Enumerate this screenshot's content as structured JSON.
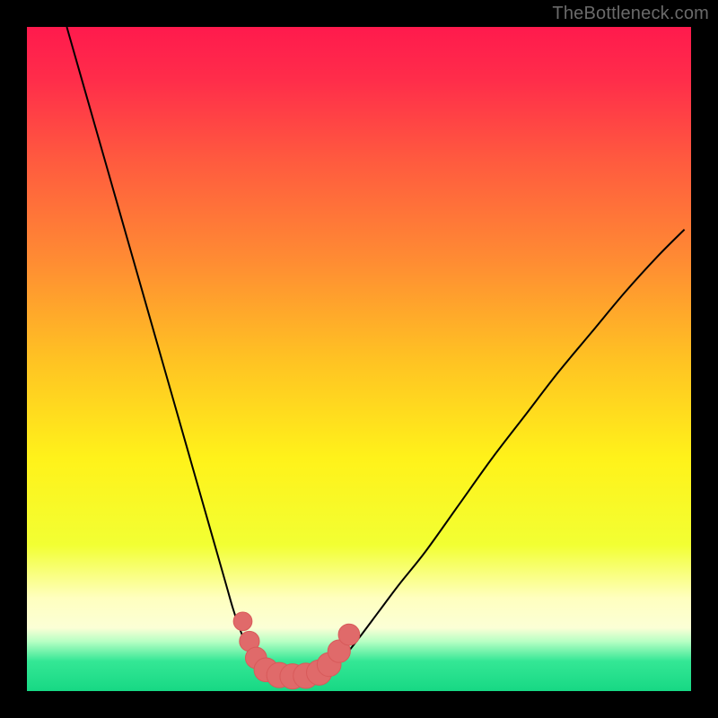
{
  "watermark": "TheBottleneck.com",
  "colors": {
    "frame": "#000000",
    "gradient_stops": [
      {
        "offset": 0.0,
        "color": "#ff1a4d"
      },
      {
        "offset": 0.08,
        "color": "#ff2d4a"
      },
      {
        "offset": 0.2,
        "color": "#ff5a3f"
      },
      {
        "offset": 0.35,
        "color": "#ff8b33"
      },
      {
        "offset": 0.5,
        "color": "#ffc223"
      },
      {
        "offset": 0.65,
        "color": "#fff21a"
      },
      {
        "offset": 0.78,
        "color": "#f2ff33"
      },
      {
        "offset": 0.86,
        "color": "#ffffbf"
      },
      {
        "offset": 0.905,
        "color": "#fbffd6"
      },
      {
        "offset": 0.925,
        "color": "#b8ffc4"
      },
      {
        "offset": 0.955,
        "color": "#34e795"
      },
      {
        "offset": 1.0,
        "color": "#17d884"
      }
    ],
    "curve": "#000000",
    "marker_fill": "#e06a6a",
    "marker_stroke": "#d85a5a"
  },
  "chart_data": {
    "type": "line",
    "title": "",
    "xlabel": "",
    "ylabel": "",
    "xlim": [
      0,
      100
    ],
    "ylim": [
      0,
      100
    ],
    "series": [
      {
        "name": "left-curve",
        "x": [
          6,
          8,
          10,
          12,
          14,
          16,
          18,
          20,
          22,
          24,
          26,
          28,
          30,
          31,
          32,
          33,
          34,
          35,
          36
        ],
        "y": [
          100,
          93,
          86,
          79,
          72,
          65,
          58,
          51,
          44,
          37,
          30,
          23,
          16,
          12.5,
          9.5,
          7,
          5,
          3.5,
          2.5
        ]
      },
      {
        "name": "right-curve",
        "x": [
          45,
          46,
          48,
          50,
          53,
          56,
          60,
          65,
          70,
          75,
          80,
          85,
          90,
          95,
          99
        ],
        "y": [
          2.5,
          3.5,
          5.5,
          8,
          12,
          16,
          21,
          28,
          35,
          41.5,
          48,
          54,
          60,
          65.5,
          69.5
        ]
      },
      {
        "name": "floor",
        "x": [
          36,
          38,
          40,
          42,
          44,
          45
        ],
        "y": [
          2.5,
          2.2,
          2.1,
          2.1,
          2.2,
          2.5
        ]
      }
    ],
    "markers": {
      "name": "bottleneck-markers",
      "points": [
        {
          "x": 32.5,
          "y": 10.5,
          "r": 1.4
        },
        {
          "x": 33.5,
          "y": 7.5,
          "r": 1.5
        },
        {
          "x": 34.5,
          "y": 5.0,
          "r": 1.6
        },
        {
          "x": 36.0,
          "y": 3.2,
          "r": 1.8
        },
        {
          "x": 38.0,
          "y": 2.4,
          "r": 1.9
        },
        {
          "x": 40.0,
          "y": 2.2,
          "r": 1.9
        },
        {
          "x": 42.0,
          "y": 2.3,
          "r": 1.9
        },
        {
          "x": 44.0,
          "y": 2.8,
          "r": 1.9
        },
        {
          "x": 45.5,
          "y": 4.0,
          "r": 1.8
        },
        {
          "x": 47.0,
          "y": 6.0,
          "r": 1.7
        },
        {
          "x": 48.5,
          "y": 8.5,
          "r": 1.6
        }
      ]
    }
  }
}
